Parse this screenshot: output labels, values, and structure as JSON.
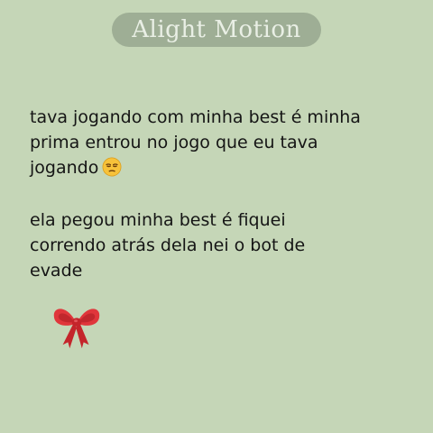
{
  "watermark": {
    "label": "Alight Motion"
  },
  "post": {
    "paragraph1": "tava jogando com minha best é minha\nprima entrou no jogo que eu tava\njogando",
    "paragraph1_emoji": "unamused-face-icon",
    "paragraph2": "ela pegou minha best é fiquei\ncorrendo atrás dela nei o bot de\nevade",
    "decoration": "ribbon-bow-icon"
  },
  "colors": {
    "background": "#c5d6b7",
    "text": "#151515",
    "bow": "#d93035"
  }
}
